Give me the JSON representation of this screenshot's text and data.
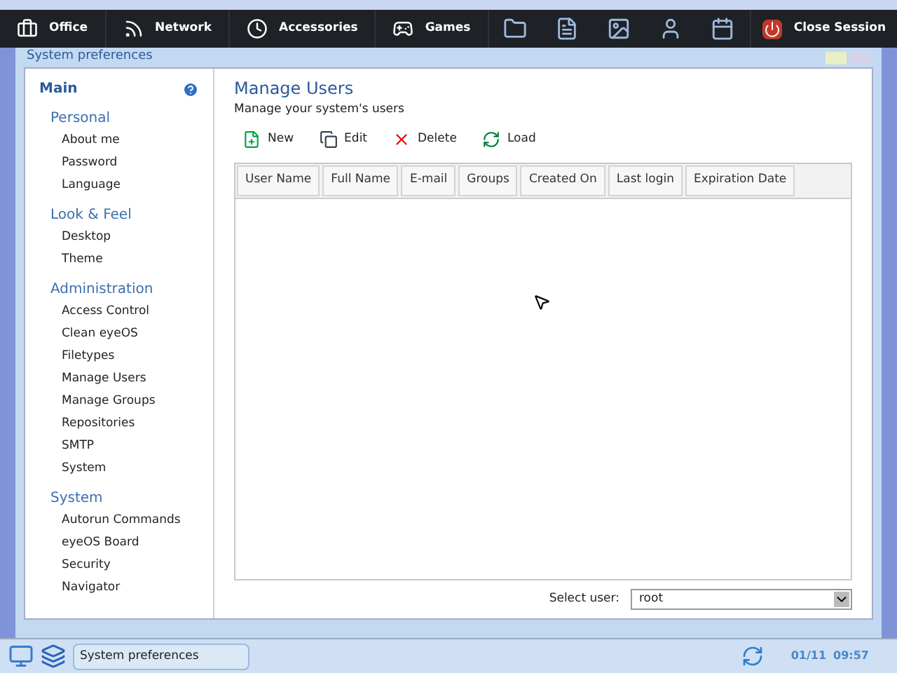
{
  "top_menu": [
    {
      "label": "Office"
    },
    {
      "label": "Network"
    },
    {
      "label": "Accessories"
    },
    {
      "label": "Games"
    }
  ],
  "close_session": "Close Session",
  "window": {
    "title": "System preferences"
  },
  "sidebar": {
    "title": "Main",
    "sections": [
      {
        "title": "Personal",
        "items": [
          {
            "label": "About me",
            "selected": false
          },
          {
            "label": "Password",
            "selected": false
          },
          {
            "label": "Language",
            "selected": false
          }
        ]
      },
      {
        "title": "Look & Feel",
        "items": [
          {
            "label": "Desktop",
            "selected": false
          },
          {
            "label": "Theme",
            "selected": false
          }
        ]
      },
      {
        "title": "Administration",
        "items": [
          {
            "label": "Access Control",
            "selected": false
          },
          {
            "label": "Clean eyeOS",
            "selected": false
          },
          {
            "label": "Filetypes",
            "selected": false
          },
          {
            "label": "Manage Users",
            "selected": false
          },
          {
            "label": "Manage Groups",
            "selected": false
          },
          {
            "label": "Repositories",
            "selected": false
          },
          {
            "label": "SMTP",
            "selected": false
          },
          {
            "label": "System",
            "selected": false
          }
        ]
      },
      {
        "title": "System",
        "items": [
          {
            "label": "Autorun Commands",
            "selected": false
          },
          {
            "label": "eyeOS Board",
            "selected": false
          },
          {
            "label": "Security",
            "selected": false
          },
          {
            "label": "Navigator",
            "selected": false
          }
        ]
      }
    ]
  },
  "content": {
    "title": "Manage Users",
    "subtitle": "Manage your system's users",
    "toolbar": [
      {
        "label": "New",
        "kind": "new"
      },
      {
        "label": "Edit",
        "kind": "edit"
      },
      {
        "label": "Delete",
        "kind": "delete"
      },
      {
        "label": "Load",
        "kind": "load"
      }
    ],
    "table": {
      "columns": [
        "User Name",
        "Full Name",
        "E-mail",
        "Groups",
        "Created On",
        "Last login",
        "Expiration Date"
      ]
    },
    "select_user": {
      "label": "Select user:",
      "value": "root"
    }
  },
  "taskbar": {
    "task": "System preferences",
    "date": "01/11",
    "time": "09:57"
  }
}
